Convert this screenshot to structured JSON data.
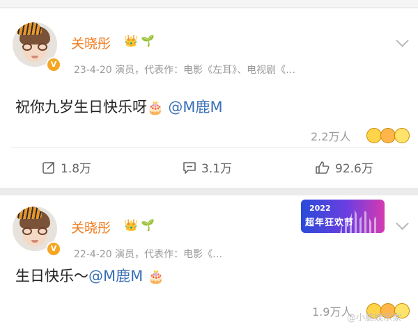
{
  "posts": [
    {
      "author": "关晓彤",
      "meta": "23-4-20  演员，代表作：电影《左耳》、电视剧《…",
      "text_before": "祝你九岁生日快乐呀",
      "cake": "🎂",
      "mention": "@M鹿M",
      "likes_text": "2.2万人",
      "forward": "1.8万",
      "comment": "3.1万",
      "like": "92.6万"
    },
    {
      "author": "关晓彤",
      "meta": "22-4-20  演员，代表作：电影《…",
      "text_before": "生日快乐～",
      "mention": "@M鹿M",
      "cake": "🎂",
      "likes_text": "1.9万人",
      "banner_year": "2022",
      "banner_slogan": "超年狂欢节"
    }
  ],
  "icons": {
    "crown": "👑",
    "sprout": "🌱",
    "verified": "V"
  },
  "watermark": "@小脑娱乐家"
}
